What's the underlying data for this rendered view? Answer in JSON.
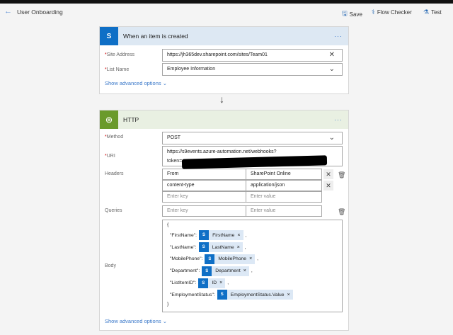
{
  "header": {
    "title": "User Onboarding",
    "save": "Save",
    "flow_checker": "Flow Checker",
    "test": "Test"
  },
  "trigger": {
    "title": "When an item is created",
    "site_address_label": "Site Address",
    "site_address": "https://jh365dev.sharepoint.com/sites/Team01",
    "list_name_label": "List Name",
    "list_name": "Employee Information",
    "advanced": "Show advanced options"
  },
  "http": {
    "title": "HTTP",
    "method_label": "Method",
    "method": "POST",
    "uri_label": "URI",
    "uri_line1": "https://s9events.azure-automation.net/webhooks?",
    "uri_line2": "token=",
    "headers_label": "Headers",
    "headers": [
      {
        "key": "From",
        "value": "SharePoint Online"
      },
      {
        "key": "content-type",
        "value": "application/json"
      }
    ],
    "key_placeholder": "Enter key",
    "value_placeholder": "Enter value",
    "queries_label": "Queries",
    "body_label": "Body",
    "body_open": "{",
    "body_close": "}",
    "body_fields": [
      {
        "key": "\"FirstName\":",
        "token": "FirstName"
      },
      {
        "key": "\"LastName\":",
        "token": "LastName"
      },
      {
        "key": "\"MobilePhone\":",
        "token": "MobilePhone"
      },
      {
        "key": "\"Department\":",
        "token": "Department"
      },
      {
        "key": "\"ListItemID\":",
        "token": "ID"
      },
      {
        "key": "\"EmploymentStatus\":",
        "token": "EmploymentStatus.Value"
      }
    ],
    "advanced": "Show advanced options"
  }
}
